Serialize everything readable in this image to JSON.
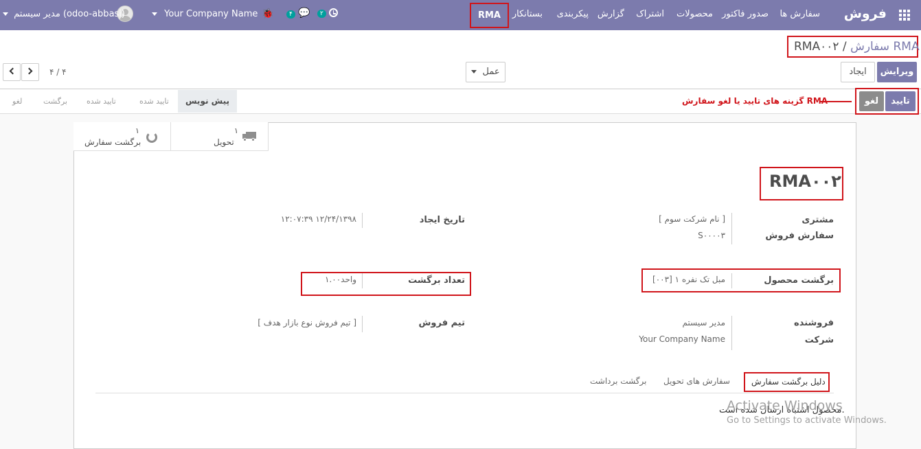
{
  "topbar": {
    "app_name": "فروش",
    "menu": [
      "سفارش ها",
      "صدور فاکتور",
      "محصولات",
      "اشتراک",
      "گزارش",
      "پیکربندی",
      "بستانکار",
      "RMA"
    ],
    "activity_count": "۲",
    "chat_count": "۴",
    "company": "Your Company Name",
    "user": "مدیر سیستم (odoo-abbasi)"
  },
  "breadcrumb": {
    "parent": "سفارش RMA",
    "separator": "/",
    "current": "RMA۰۰۲"
  },
  "buttons": {
    "edit": "ویرایش",
    "create": "ایجاد",
    "action": "عمل"
  },
  "pager": {
    "value": "۴ / ۴"
  },
  "statusbar": {
    "stages": [
      "پیش نویس",
      "تایید شده",
      "تایید شده",
      "برگشت",
      "لغو"
    ],
    "active_index": 0,
    "confirm": "تایید",
    "cancel": "لغو",
    "annotation": "گزینه های تایید یا لغو سفارش RMA"
  },
  "smart_buttons": [
    {
      "count": "۱",
      "label": "تحویل",
      "icon": "truck-icon"
    },
    {
      "count": "۱",
      "label": "برگشت سفارش",
      "icon": "undo-icon"
    }
  ],
  "form": {
    "title": "RMA۰۰۲",
    "customer_label": "مشتری",
    "customer_value": "[ نام شرکت سوم ]",
    "sale_order_label": "سفارش فروش",
    "sale_order_value": "S۰۰۰۰۳",
    "create_date_label": "تاریخ ایجاد",
    "create_date_value": "۱۲:۰۷:۳۹ ۱۲/۲۴/۱۳۹۸",
    "product_label": "برگشت محصول",
    "product_value": "[۰۰۳] مبل تک نفره ۱",
    "qty_label": "تعداد برگشت",
    "qty_value": "۱.۰۰واحد",
    "salesperson_label": "فروشنده",
    "salesperson_value": "مدیر سیستم",
    "company_label": "شرکت",
    "company_value": "Your Company Name",
    "team_label": "تیم فروش",
    "team_value": "[ تیم فروش نوع بازار هدف ]"
  },
  "tabs": [
    "دلیل برگشت سفارش",
    "سفارش های تحویل",
    "برگشت برداشت"
  ],
  "tab_content": "محصول اشتباه ارسال شده است.",
  "watermark": {
    "title": "Activate Windows",
    "subtitle": "Go to Settings to activate Windows."
  },
  "colors": {
    "primary": "#7c7bad",
    "highlight": "#d0141a",
    "badge": "#00a09d"
  }
}
